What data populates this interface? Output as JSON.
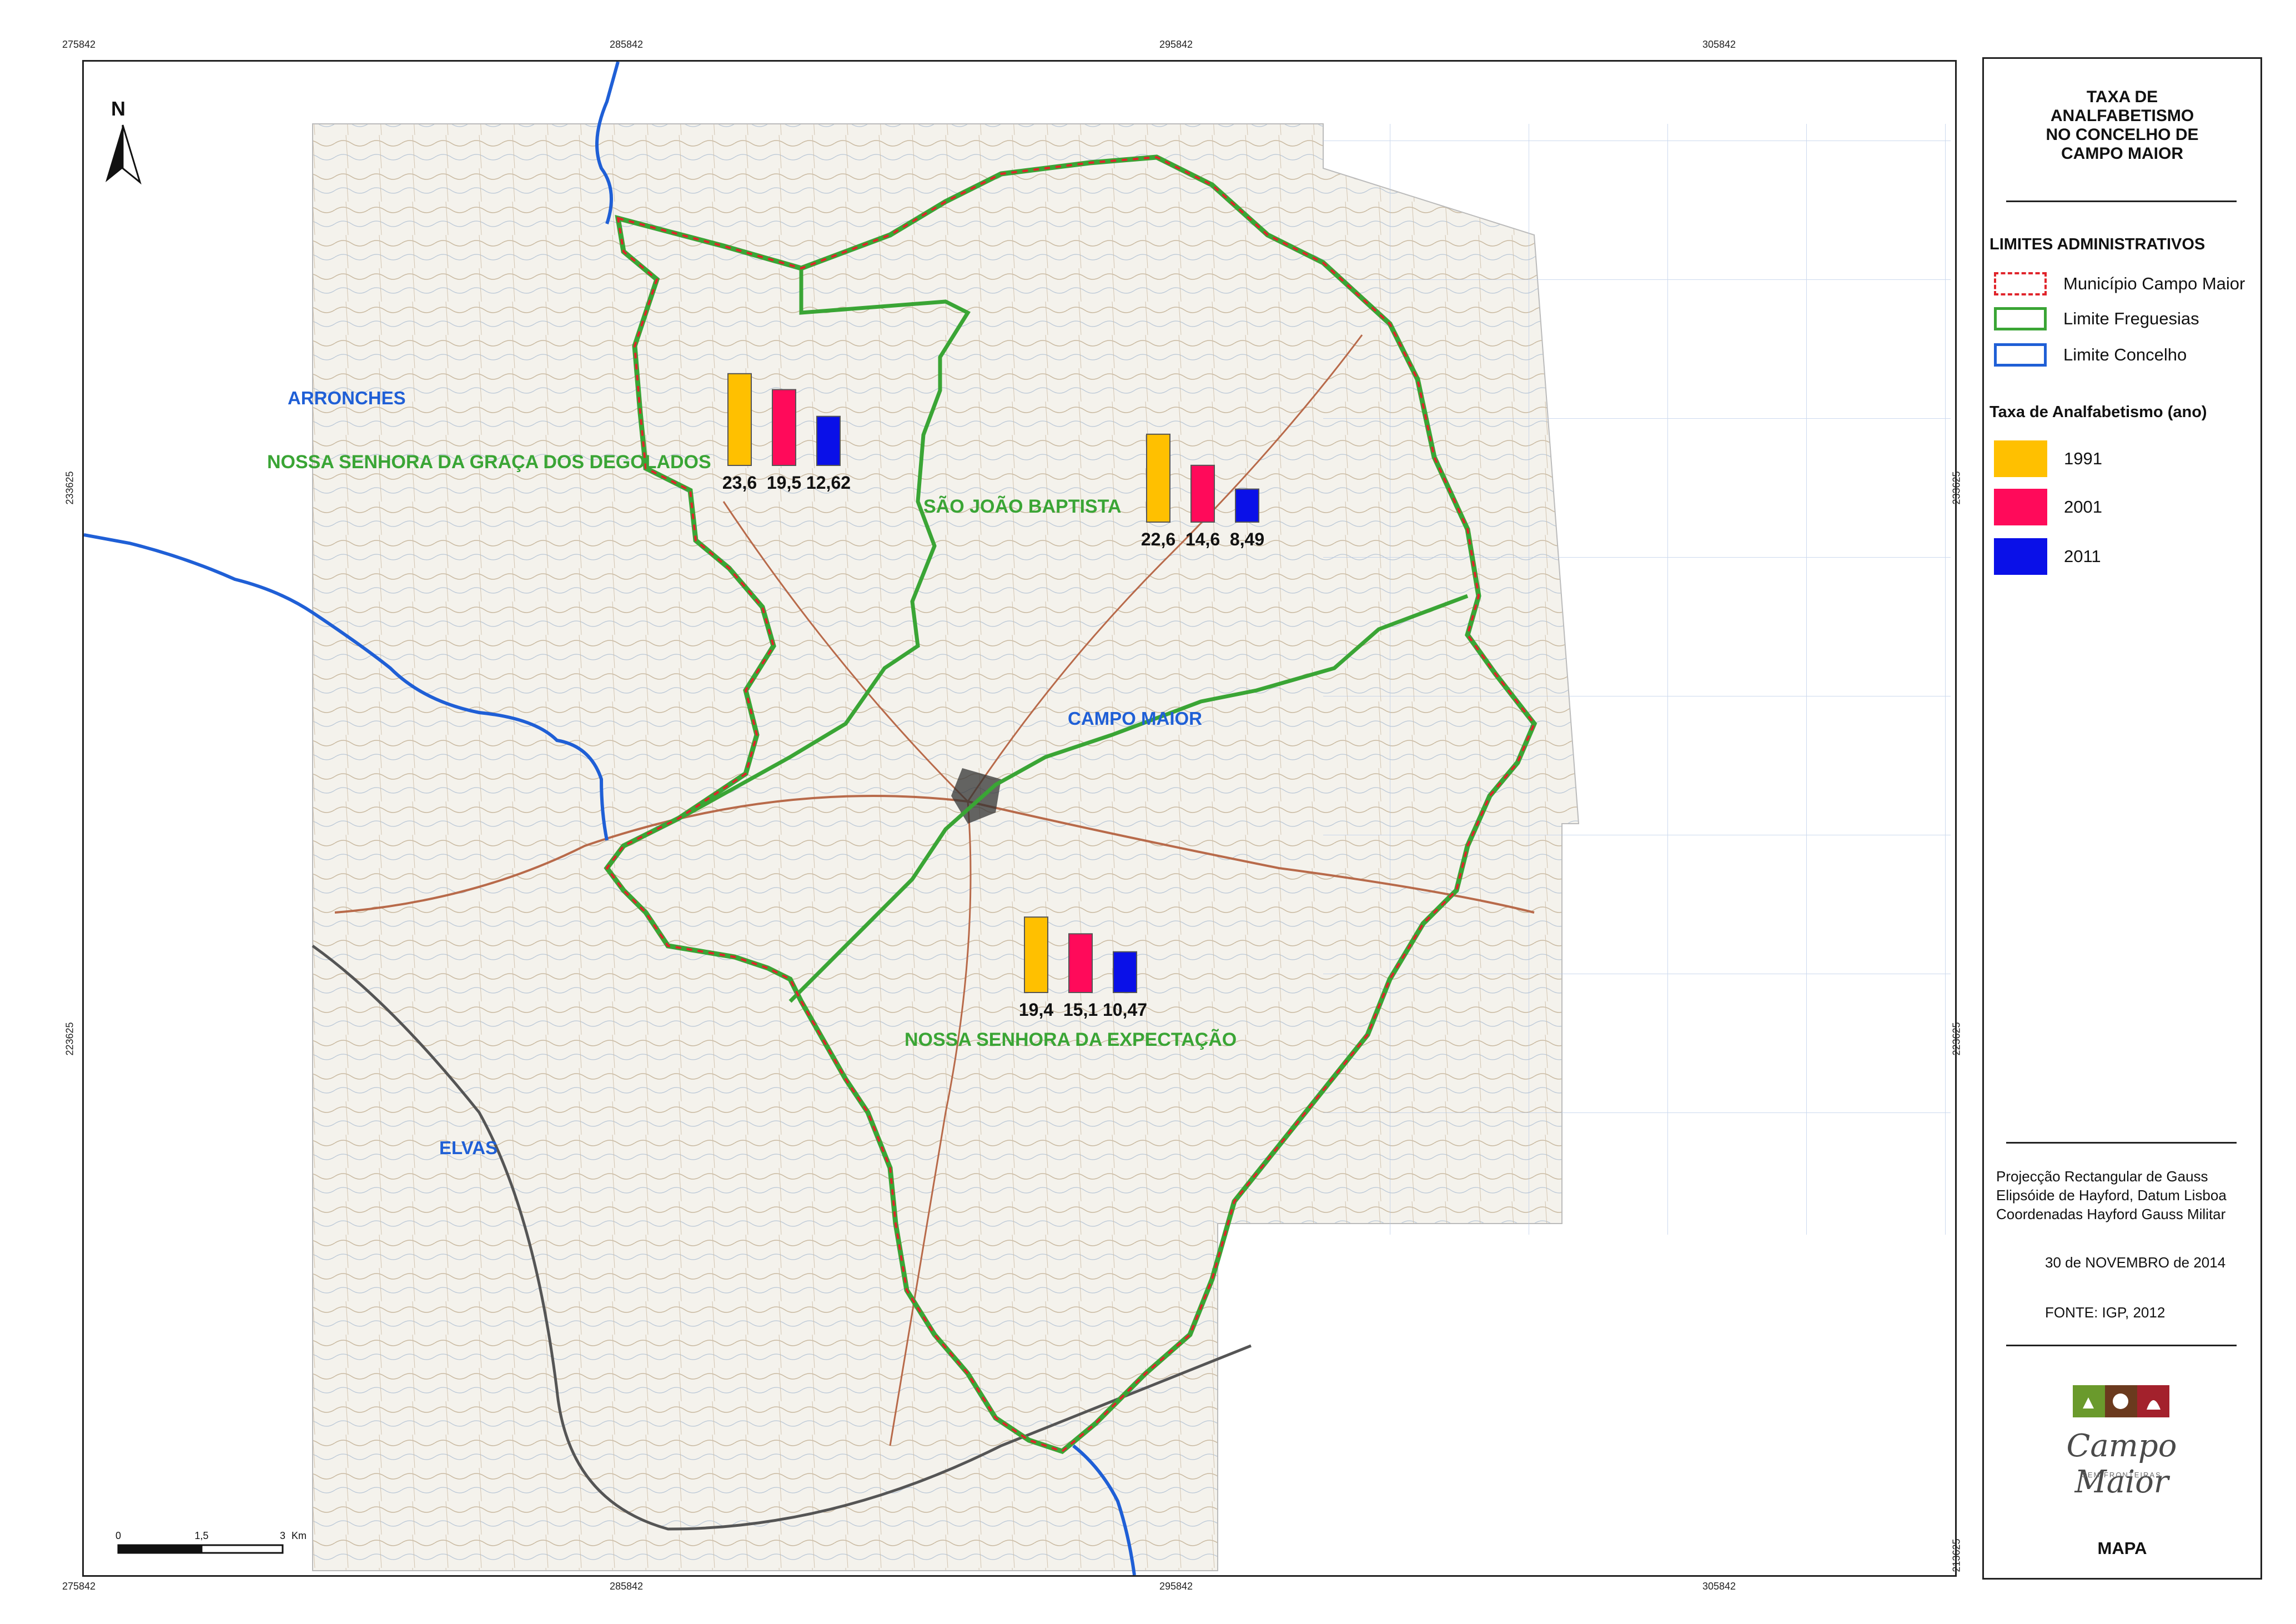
{
  "legend": {
    "title": "TAXA DE ANALFABETISMO NO CONCELHO DE CAMPO MAIOR",
    "title_lines": [
      "TAXA DE",
      "ANALFABETISMO",
      "NO CONCELHO DE",
      "CAMPO MAIOR"
    ],
    "limits_heading": "LIMITES ADMINISTRATIVOS",
    "limits": [
      {
        "label": "Município Campo Maior",
        "style": "dashed-red",
        "color": "#e0242b"
      },
      {
        "label": "Limite Freguesias",
        "style": "solid-green",
        "color": "#3aa535"
      },
      {
        "label": "Limite Concelho",
        "style": "solid-blue",
        "color": "#1f5fd6"
      }
    ],
    "rate_heading": "Taxa de Analfabetismo (ano)",
    "years": [
      {
        "label": "1991",
        "color": "#ffc000"
      },
      {
        "label": "2001",
        "color": "#ff0a5a"
      },
      {
        "label": "2011",
        "color": "#0a10e8"
      }
    ],
    "projection": [
      "Projecção  Rectangular de Gauss",
      "Elipsóide de Hayford, Datum Lisboa",
      "Coordenadas Hayford Gauss Militar"
    ],
    "date": "30 de NOVEMBRO de 2014",
    "source": "FONTE: IGP, 2012",
    "logo_text": "Campo Maior",
    "logo_sub": "SEM FRONTEIRAS",
    "footer": "MAPA"
  },
  "coords": {
    "top": [
      "275842",
      "285842",
      "295842",
      "305842"
    ],
    "bottom": [
      "275842",
      "285842",
      "295842",
      "305842"
    ],
    "left": [
      "233625",
      "223625"
    ],
    "right": [
      "233625",
      "223625",
      "213625"
    ]
  },
  "north": "N",
  "scale": {
    "labels": [
      "0",
      "1,5",
      "3"
    ],
    "unit": "Km"
  },
  "places": [
    {
      "name": "ARRONCHES",
      "color": "#1f5fd6"
    },
    {
      "name": "CAMPO MAIOR",
      "color": "#1f5fd6"
    },
    {
      "name": "ELVAS",
      "color": "#1f5fd6"
    }
  ],
  "parishes": [
    {
      "name": "NOSSA SENHORA DA GRAÇA DOS DEGOLADOS",
      "color": "#3aa535",
      "values": [
        23.6,
        19.5,
        12.62
      ],
      "labels": [
        "23,6",
        "19,5",
        "12,62"
      ]
    },
    {
      "name": "SÃO JOÃO BAPTISTA",
      "color": "#3aa535",
      "values": [
        22.6,
        14.6,
        8.49
      ],
      "labels": [
        "22,6",
        "14,6",
        "8,49"
      ]
    },
    {
      "name": "NOSSA SENHORA DA EXPECTAÇÃO",
      "color": "#3aa535",
      "values": [
        19.4,
        15.1,
        10.47
      ],
      "labels": [
        "19,4",
        "15,1",
        "10,47"
      ]
    }
  ]
}
